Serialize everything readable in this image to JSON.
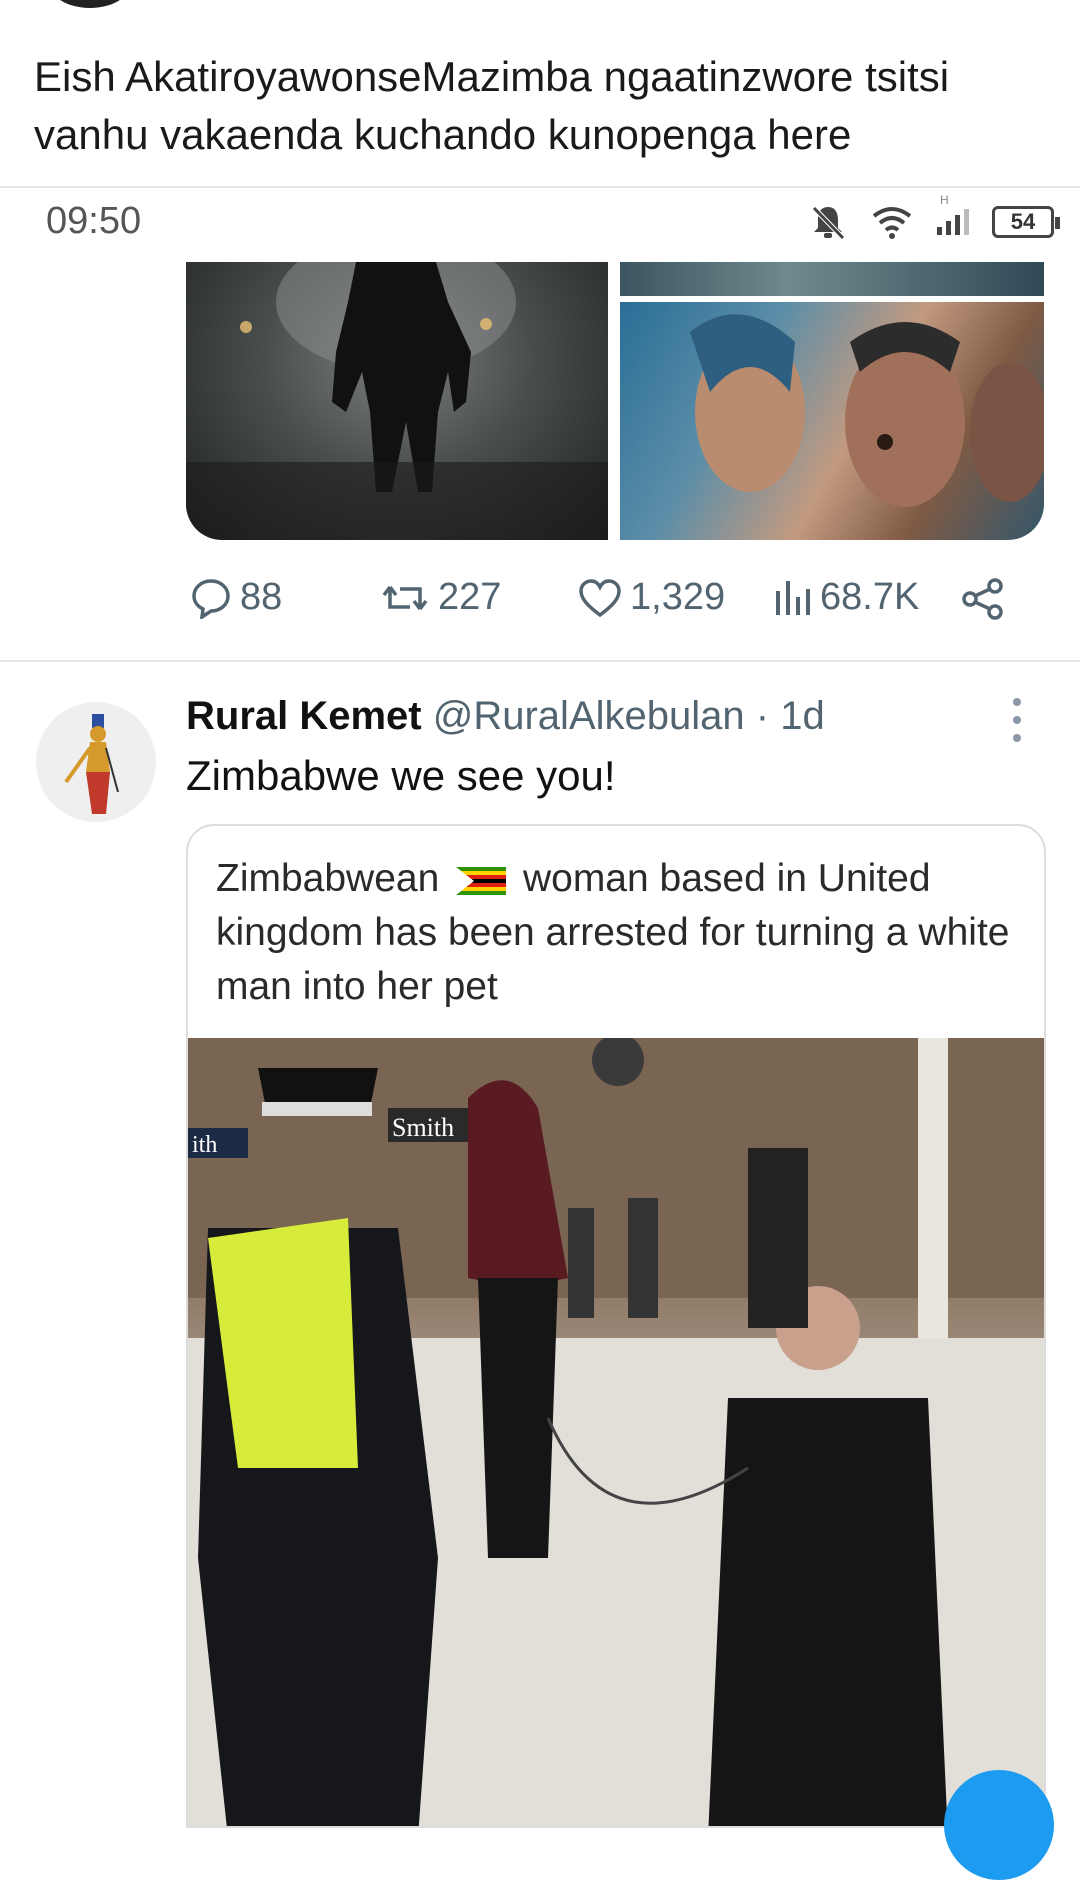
{
  "post": {
    "caption": "Eish AkatiroyawonseMazimba ngaatinzwore tsitsi vanhu vakaenda kuchando kunopenga here"
  },
  "status_bar": {
    "time": "09:50",
    "battery": "54",
    "network_label": "H",
    "icons": [
      "bell-muted-icon",
      "wifi-icon",
      "signal-icon",
      "battery-icon"
    ]
  },
  "first_tweet": {
    "media": [
      "silhouette-warrior-image",
      "face-to-face-image"
    ],
    "actions": {
      "replies": "88",
      "retweets": "227",
      "likes": "1,329",
      "views": "68.7K"
    }
  },
  "second_tweet": {
    "display_name": "Rural Kemet",
    "handle": "@RuralAlkebulan",
    "separator": "·",
    "time_ago": "1d",
    "text": "Zimbabwe we see you!",
    "quote": {
      "text_before_flag": "Zimbabwean",
      "text_after_flag": "woman based in United kingdom has been arrested for turning a white man into her pet",
      "photo_signs": [
        "ith",
        "Smith"
      ]
    }
  },
  "colors": {
    "muted_text": "#536471",
    "accent": "#1d9bf0"
  }
}
